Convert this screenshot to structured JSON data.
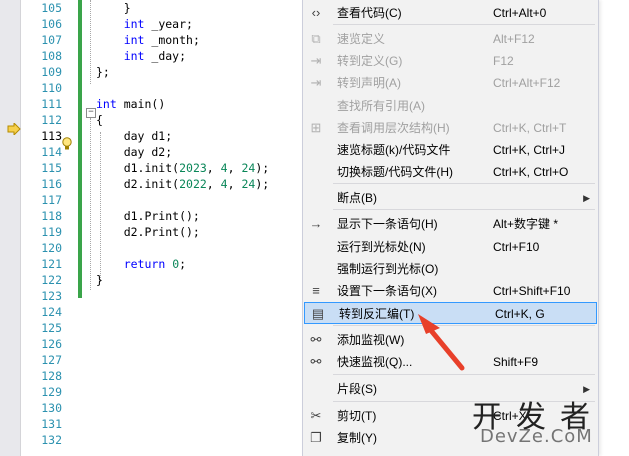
{
  "editor": {
    "line_numbers": [
      "105",
      "106",
      "107",
      "108",
      "109",
      "110",
      "111",
      "112",
      "113",
      "114",
      "115",
      "116",
      "117",
      "118",
      "119",
      "120",
      "121",
      "122",
      "123",
      "124",
      "125",
      "126",
      "127",
      "128",
      "129",
      "130",
      "131",
      "132"
    ],
    "current_line": "113",
    "code_lines": [
      {
        "parts": [
          {
            "t": "    }",
            "c": ""
          }
        ]
      },
      {
        "parts": [
          {
            "t": "    ",
            "c": ""
          },
          {
            "t": "int",
            "c": "kw"
          },
          {
            "t": " _year;",
            "c": ""
          }
        ]
      },
      {
        "parts": [
          {
            "t": "    ",
            "c": ""
          },
          {
            "t": "int",
            "c": "kw"
          },
          {
            "t": " _month;",
            "c": ""
          }
        ]
      },
      {
        "parts": [
          {
            "t": "    ",
            "c": ""
          },
          {
            "t": "int",
            "c": "kw"
          },
          {
            "t": " _day;",
            "c": ""
          }
        ]
      },
      {
        "parts": [
          {
            "t": "};",
            "c": ""
          }
        ]
      },
      {
        "parts": []
      },
      {
        "parts": [
          {
            "t": "int",
            "c": "kw"
          },
          {
            "t": " main()",
            "c": ""
          }
        ]
      },
      {
        "parts": [
          {
            "t": "{",
            "c": ""
          }
        ]
      },
      {
        "parts": [
          {
            "t": "    day d1;",
            "c": ""
          }
        ]
      },
      {
        "parts": [
          {
            "t": "    day d2;",
            "c": ""
          }
        ]
      },
      {
        "parts": [
          {
            "t": "    d1.init(",
            "c": ""
          },
          {
            "t": "2023",
            "c": "num"
          },
          {
            "t": ", ",
            "c": ""
          },
          {
            "t": "4",
            "c": "num"
          },
          {
            "t": ", ",
            "c": ""
          },
          {
            "t": "24",
            "c": "num"
          },
          {
            "t": ");",
            "c": ""
          }
        ]
      },
      {
        "parts": [
          {
            "t": "    d2.init(",
            "c": ""
          },
          {
            "t": "2022",
            "c": "num"
          },
          {
            "t": ", ",
            "c": ""
          },
          {
            "t": "4",
            "c": "num"
          },
          {
            "t": ", ",
            "c": ""
          },
          {
            "t": "24",
            "c": "num"
          },
          {
            "t": ");",
            "c": ""
          }
        ]
      },
      {
        "parts": []
      },
      {
        "parts": [
          {
            "t": "    d1.Print();",
            "c": ""
          }
        ]
      },
      {
        "parts": [
          {
            "t": "    d2.Print();",
            "c": ""
          }
        ]
      },
      {
        "parts": []
      },
      {
        "parts": [
          {
            "t": "    ",
            "c": ""
          },
          {
            "t": "return",
            "c": "kw"
          },
          {
            "t": " ",
            "c": ""
          },
          {
            "t": "0",
            "c": "num"
          },
          {
            "t": ";",
            "c": ""
          }
        ]
      },
      {
        "parts": [
          {
            "t": "}",
            "c": ""
          }
        ]
      }
    ],
    "collapse_glyph": "−",
    "colors": {
      "line_number": "#2b91af",
      "keyword": "#0000ff",
      "number": "#098658",
      "changed_bar": "#3aa44a"
    }
  },
  "context_menu": {
    "items": [
      {
        "icon": "code-brackets-icon",
        "glyph": "‹›",
        "label": "查看代码(C)",
        "shortcut": "Ctrl+Alt+0",
        "disabled": false,
        "submenu": false
      },
      {
        "icon": "peek-definition-icon",
        "glyph": "⧉",
        "label": "速览定义",
        "shortcut": "Alt+F12",
        "disabled": true,
        "submenu": false
      },
      {
        "icon": "go-to-definition-icon",
        "glyph": "⇥",
        "label": "转到定义(G)",
        "shortcut": "F12",
        "disabled": true,
        "submenu": false
      },
      {
        "icon": "go-to-declaration-icon",
        "glyph": "⇥",
        "label": "转到声明(A)",
        "shortcut": "Ctrl+Alt+F12",
        "disabled": true,
        "submenu": false
      },
      {
        "icon": "",
        "glyph": "",
        "label": "查找所有引用(A)",
        "shortcut": "",
        "disabled": true,
        "submenu": false
      },
      {
        "icon": "call-hierarchy-icon",
        "glyph": "⊞",
        "label": "查看调用层次结构(H)",
        "shortcut": "Ctrl+K, Ctrl+T",
        "disabled": true,
        "submenu": false
      },
      {
        "icon": "",
        "glyph": "",
        "label": "速览标题(k)/代码文件",
        "shortcut": "Ctrl+K, Ctrl+J",
        "disabled": false,
        "submenu": false
      },
      {
        "icon": "",
        "glyph": "",
        "label": "切换标题/代码文件(H)",
        "shortcut": "Ctrl+K, Ctrl+O",
        "disabled": false,
        "submenu": false
      },
      {
        "icon": "",
        "glyph": "",
        "label": "断点(B)",
        "shortcut": "",
        "disabled": false,
        "submenu": true
      },
      {
        "icon": "show-next-statement-icon",
        "glyph": "→",
        "label": "显示下一条语句(H)",
        "shortcut": "Alt+数字键 *",
        "disabled": false,
        "submenu": false
      },
      {
        "icon": "",
        "glyph": "",
        "label": "运行到光标处(N)",
        "shortcut": "Ctrl+F10",
        "disabled": false,
        "submenu": false
      },
      {
        "icon": "",
        "glyph": "",
        "label": "强制运行到光标(O)",
        "shortcut": "",
        "disabled": false,
        "submenu": false
      },
      {
        "icon": "set-next-statement-icon",
        "glyph": "≡",
        "label": "设置下一条语句(X)",
        "shortcut": "Ctrl+Shift+F10",
        "disabled": false,
        "submenu": false
      },
      {
        "icon": "disassembly-icon",
        "glyph": "▤",
        "label": "转到反汇编(T)",
        "shortcut": "Ctrl+K, G",
        "disabled": false,
        "submenu": false,
        "highlighted": true
      },
      {
        "icon": "add-watch-icon",
        "glyph": "⚯",
        "label": "添加监视(W)",
        "shortcut": "",
        "disabled": false,
        "submenu": false
      },
      {
        "icon": "quick-watch-icon",
        "glyph": "⚯",
        "label": "快速监视(Q)...",
        "shortcut": "Shift+F9",
        "disabled": false,
        "submenu": false
      },
      {
        "icon": "",
        "glyph": "",
        "label": "片段(S)",
        "shortcut": "",
        "disabled": false,
        "submenu": true
      },
      {
        "icon": "cut-icon",
        "glyph": "✂",
        "label": "剪切(T)",
        "shortcut": "Ctrl+X",
        "disabled": false,
        "submenu": false
      },
      {
        "icon": "copy-icon",
        "glyph": "❐",
        "label": "复制(Y)",
        "shortcut": "",
        "disabled": false,
        "submenu": false
      }
    ],
    "submenu_glyph": "▶",
    "highlight_color": "#c9def5"
  },
  "watermark": {
    "line1": "开发者",
    "line2": "DevZe.CoM"
  }
}
